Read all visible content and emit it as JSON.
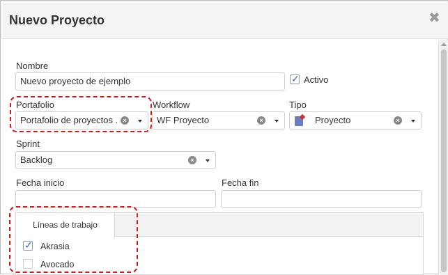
{
  "dialog": {
    "title": "Nuevo Proyecto",
    "close_glyph": "✖"
  },
  "form": {
    "nombre": {
      "label": "Nombre",
      "value": "Nuevo proyecto de ejemplo"
    },
    "activo": {
      "label": "Activo",
      "checked": true
    },
    "portafolio": {
      "label": "Portafolio",
      "value": "Portafolio de proyectos ..."
    },
    "workflow": {
      "label": "Workflow",
      "value": "WF Proyecto"
    },
    "tipo": {
      "label": "Tipo",
      "value": "Proyecto"
    },
    "sprint": {
      "label": "Sprint",
      "value": "Backlog"
    },
    "fecha_inicio": {
      "label": "Fecha inicio",
      "value": ""
    },
    "fecha_fin": {
      "label": "Fecha fin",
      "value": ""
    }
  },
  "tabs": {
    "active_label": "Líneas de trabajo",
    "items": [
      {
        "label": "Akrasia",
        "checked": true
      },
      {
        "label": "Avocado",
        "checked": false
      }
    ]
  },
  "icons": {
    "clear": "×",
    "check": "✓"
  },
  "colors": {
    "highlight": "#d21b1b",
    "check": "#2f6fb8",
    "header_bg": "#f5f5f5"
  }
}
